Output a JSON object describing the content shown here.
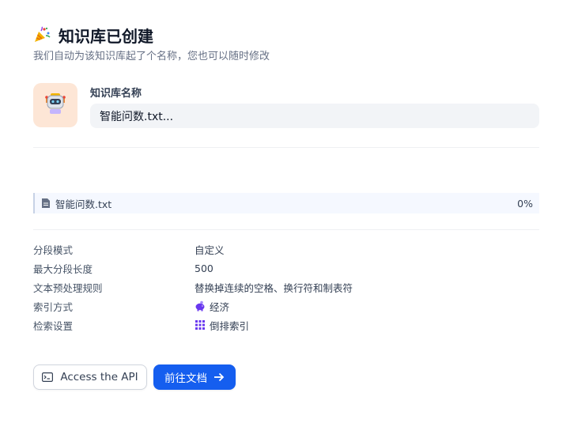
{
  "header": {
    "title": "知识库已创建",
    "subtitle": "我们自动为该知识库起了个名称，您也可以随时修改"
  },
  "name_section": {
    "label": "知识库名称",
    "value": "智能问数.txt...",
    "icon": "robot-icon"
  },
  "file": {
    "name": "智能问数.txt",
    "progress_text": "0%",
    "progress": 0
  },
  "settings": [
    {
      "key": "分段模式",
      "value": "自定义",
      "icon": ""
    },
    {
      "key": "最大分段长度",
      "value": "500",
      "icon": ""
    },
    {
      "key": "文本预处理规则",
      "value": "替换掉连续的空格、换行符和制表符",
      "icon": ""
    },
    {
      "key": "索引方式",
      "value": "经济",
      "icon": "piggy-bank-icon"
    },
    {
      "key": "检索设置",
      "value": "倒排索引",
      "icon": "grid-icon"
    }
  ],
  "buttons": {
    "api_label": "Access the API",
    "docs_label": "前往文档"
  },
  "colors": {
    "primary": "#155eef",
    "icon_bg": "#fde6d6",
    "index_icon": "#6938ef"
  }
}
